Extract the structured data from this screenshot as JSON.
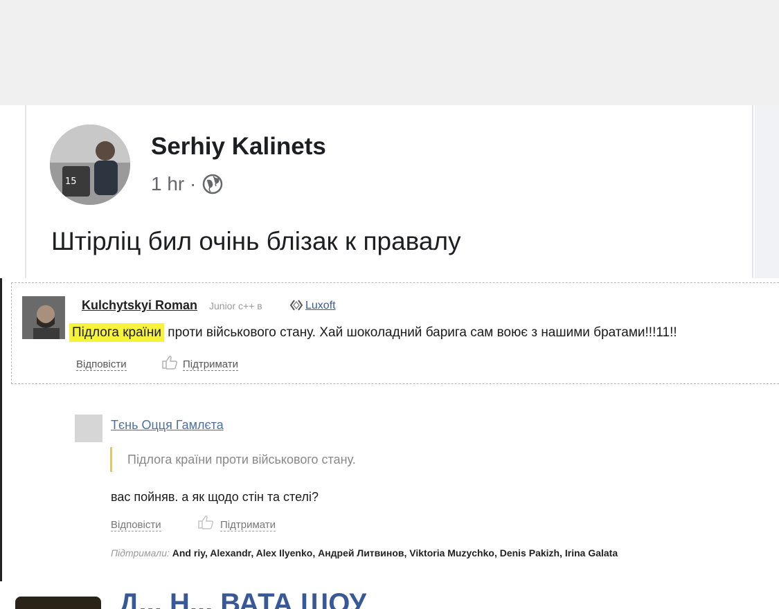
{
  "fb_post": {
    "author": "Serhiy Kalinets",
    "time": "1 hr ·",
    "text": "Штірліц бил очінь блізак к правалу",
    "icons": {
      "avatar": "avatar-photo",
      "audience": "globe-icon"
    }
  },
  "forum": {
    "comment1": {
      "author": "Kulchytskyi Roman",
      "role": "Junior c++ в",
      "company": "Luxoft",
      "highlight": "Підлога країни",
      "text_rest": " проти військового стану. Хай шоколадний барига сам воює з нашими братами!!!11!!",
      "reply_label": "Відповісти",
      "like_label": "Підтримати",
      "highlight_color": "#f7f23a"
    },
    "comment2": {
      "author": "Тєнь Оцця Гамлєта",
      "quote": "Підлога країни проти військового стану.",
      "text": "вас пойняв. а як щодо стін та стелі?",
      "reply_label": "Відповісти",
      "like_label": "Підтримати",
      "supported_label": "Підтримали:",
      "supported_names": "And riy, Alexandr, Alex Ilyenko, Андрей Литвинов, Viktoria Muzychko, Denis Pakizh, Irina Galata",
      "quote_bar_color": "#e8c36a"
    }
  },
  "bottom": {
    "title": "Д... Н... ВАТА ШОУ"
  }
}
